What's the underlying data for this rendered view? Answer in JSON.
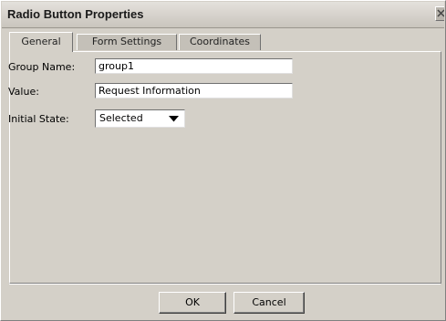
{
  "window": {
    "title": "Radio Button Properties",
    "close_icon": "close-x-icon"
  },
  "tabs": [
    {
      "label": "General",
      "active": true
    },
    {
      "label": "Form Settings",
      "active": false
    },
    {
      "label": "Coordinates",
      "active": false
    }
  ],
  "general": {
    "group_name_label": "Group Name:",
    "group_name_value": "group1",
    "value_label": "Value:",
    "value_value": "Request Information",
    "initial_state_label": "Initial State:",
    "initial_state_value": "Selected",
    "dropdown_icon": "triangle-down-icon"
  },
  "buttons": {
    "ok": "OK",
    "cancel": "Cancel"
  }
}
